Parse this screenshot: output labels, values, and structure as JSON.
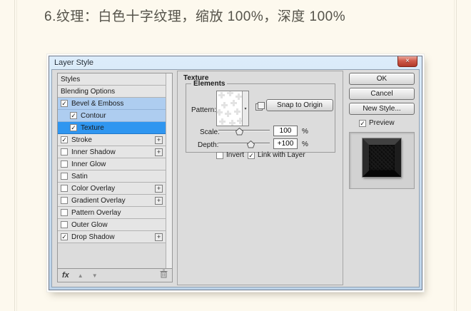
{
  "page": {
    "heading": "6.纹理：白色十字纹理，缩放 100%，深度 100%"
  },
  "window": {
    "title": "Layer Style"
  },
  "icons": {
    "close": "×",
    "check": "✓",
    "dropdown": "▾",
    "up": "▲",
    "down": "▼",
    "plus": "+",
    "fx": "fx"
  },
  "colors": {
    "selected_row": "#2f96f0",
    "active_group_rows": "#aecdf0",
    "dialog_bg": "#dcdcdc",
    "titlebar_top": "#dcecfa",
    "close_button": "#c24434",
    "page_bg": "#fdf9ee"
  },
  "sidebar": {
    "items": [
      {
        "label": "Styles",
        "has_checkbox": false
      },
      {
        "label": "Blending Options",
        "has_checkbox": false
      },
      {
        "label": "Bevel & Emboss",
        "checked": true,
        "highlight": "light"
      },
      {
        "label": "Contour",
        "checked": true,
        "highlight": "light",
        "indent": true
      },
      {
        "label": "Texture",
        "checked": true,
        "highlight": "strong",
        "indent": true,
        "selected": true
      },
      {
        "label": "Stroke",
        "checked": true,
        "plus": true
      },
      {
        "label": "Inner Shadow",
        "checked": false,
        "plus": true
      },
      {
        "label": "Inner Glow",
        "checked": false
      },
      {
        "label": "Satin",
        "checked": false
      },
      {
        "label": "Color Overlay",
        "checked": false,
        "plus": true
      },
      {
        "label": "Gradient Overlay",
        "checked": false,
        "plus": true
      },
      {
        "label": "Pattern Overlay",
        "checked": false
      },
      {
        "label": "Outer Glow",
        "checked": false
      },
      {
        "label": "Drop Shadow",
        "checked": true,
        "plus": true
      }
    ]
  },
  "panel": {
    "title": "Texture",
    "group_label": "Elements",
    "pattern_label": "Pattern:",
    "snap_button_label": "Snap to Origin",
    "sliders": {
      "scale": {
        "label": "Scale:",
        "value": "100",
        "unit": "%",
        "thumb_percent": 40
      },
      "depth": {
        "label": "Depth:",
        "value": "+100",
        "unit": "%",
        "thumb_percent": 62
      }
    },
    "invert_label": "Invert",
    "link_label": "Link with Layer"
  },
  "actions": {
    "ok": "OK",
    "cancel": "Cancel",
    "new_style": "New Style...",
    "preview": "Preview"
  }
}
